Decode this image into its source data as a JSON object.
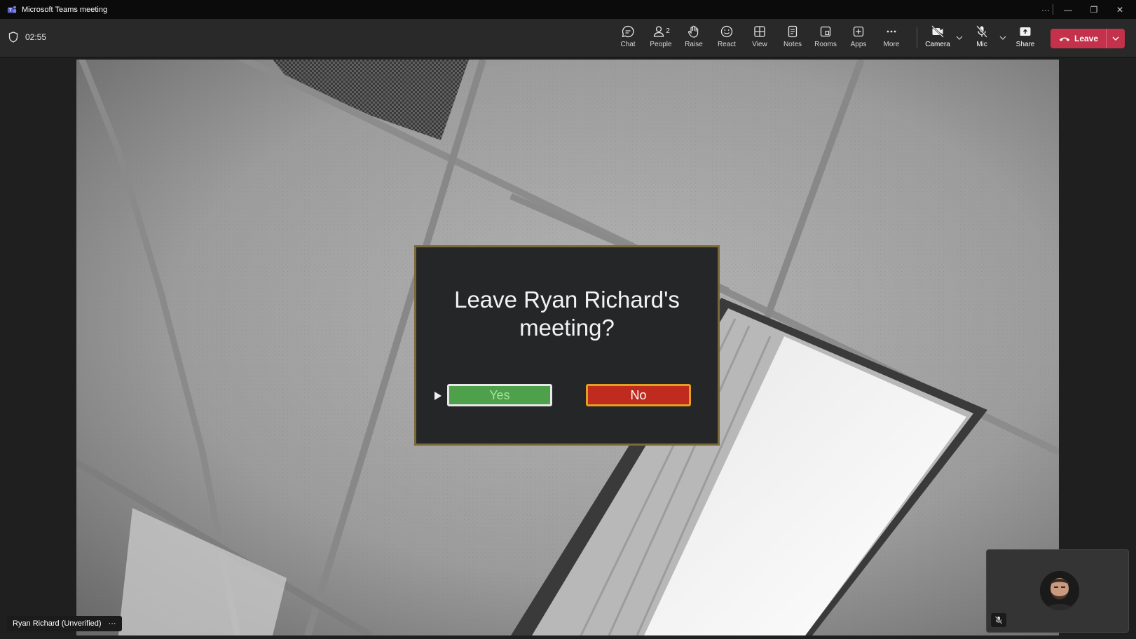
{
  "window": {
    "title": "Microsoft Teams meeting",
    "controls": {
      "more": "···",
      "minimize": "—",
      "restore": "❐",
      "close": "✕"
    }
  },
  "toolbar": {
    "timer": "02:55",
    "buttons": [
      {
        "label": "Chat",
        "icon": "chat-icon"
      },
      {
        "label": "People",
        "icon": "people-icon",
        "badge": "2"
      },
      {
        "label": "Raise",
        "icon": "raise-hand-icon"
      },
      {
        "label": "React",
        "icon": "react-icon"
      },
      {
        "label": "View",
        "icon": "view-grid-icon"
      },
      {
        "label": "Notes",
        "icon": "notes-icon"
      },
      {
        "label": "Rooms",
        "icon": "rooms-icon"
      },
      {
        "label": "Apps",
        "icon": "apps-icon"
      },
      {
        "label": "More",
        "icon": "more-icon"
      },
      {
        "label": "Camera",
        "icon": "camera-off-icon"
      },
      {
        "label": "Mic",
        "icon": "mic-off-icon"
      },
      {
        "label": "Share",
        "icon": "share-icon"
      }
    ],
    "leave_label": "Leave",
    "leave_color": "#c4314b"
  },
  "video": {
    "dialog": {
      "message": "Leave Ryan Richard's meeting?",
      "yes_label": "Yes",
      "no_label": "No"
    }
  },
  "participant": {
    "name": "Ryan Richard (Unverified)",
    "more": "···"
  }
}
